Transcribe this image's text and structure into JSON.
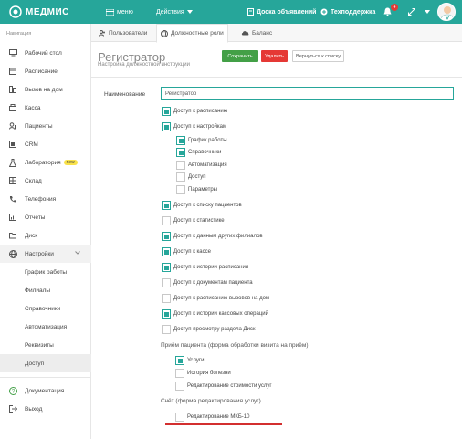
{
  "topbar": {
    "logo": "МЕДМИС",
    "menu": "меню",
    "actions": "Действия",
    "board": "Доска объявлений",
    "support": "Техподдержка",
    "notifications_count": "4"
  },
  "sidebar": {
    "caption": "Навигация",
    "items": [
      {
        "label": "Рабочий стол",
        "icon": "monitor-icon"
      },
      {
        "label": "Расписание",
        "icon": "calendar-icon"
      },
      {
        "label": "Вызов на дом",
        "icon": "car-icon"
      },
      {
        "label": "Касса",
        "icon": "cash-icon"
      },
      {
        "label": "Пациенты",
        "icon": "patients-icon"
      },
      {
        "label": "CRM",
        "icon": "crm-icon"
      },
      {
        "label": "Лаборатория",
        "icon": "flask-icon",
        "badge": "new"
      },
      {
        "label": "Склад",
        "icon": "warehouse-icon"
      },
      {
        "label": "Телефония",
        "icon": "phone-icon"
      },
      {
        "label": "Отчеты",
        "icon": "reports-icon"
      },
      {
        "label": "Диск",
        "icon": "disk-icon"
      },
      {
        "label": "Настройки",
        "icon": "globe-icon"
      }
    ],
    "settings_sub": [
      "График работы",
      "Филиалы",
      "Справочники",
      "Автоматизация",
      "Реквизиты",
      "Доступ"
    ],
    "bottom": [
      {
        "label": "Документация",
        "icon": "help-icon"
      },
      {
        "label": "Выход",
        "icon": "logout-icon"
      }
    ]
  },
  "tabs": [
    "Пользователи",
    "Должностные роли",
    "Баланс"
  ],
  "page": {
    "title": "Регистратор",
    "subtitle": "Настройка должностной инструкции",
    "save": "Сохранить",
    "delete": "Удалить",
    "back": "Вернуться к списку"
  },
  "form": {
    "name_label": "Наименование",
    "name_value": "Регистратор",
    "permissions": [
      {
        "label": "Доступ к расписанию",
        "checked": true
      },
      {
        "label": "Доступ к настройкам",
        "checked": true
      },
      {
        "label": "График работы",
        "checked": true
      },
      {
        "label": "Справочники",
        "checked": true
      },
      {
        "label": "Автоматизация",
        "checked": false
      },
      {
        "label": "Доступ",
        "checked": false
      },
      {
        "label": "Параметры",
        "checked": false
      },
      {
        "label": "Доступ к списку пациентов",
        "checked": true
      },
      {
        "label": "Доступ к статистике",
        "checked": false
      },
      {
        "label": "Доступ к данным других филиалов",
        "checked": true
      },
      {
        "label": "Доступ к кассе",
        "checked": true
      },
      {
        "label": "Доступ к истории расписания",
        "checked": true
      },
      {
        "label": "Доступ к документам пациента",
        "checked": false
      },
      {
        "label": "Доступ к расписанию вызовов на дом",
        "checked": false
      },
      {
        "label": "Доступ к истории кассовых операций",
        "checked": true
      },
      {
        "label": "Доступ просмотру раздела Диск",
        "checked": false
      }
    ],
    "reception_title": "Приём пациента (форма обработки визита на приём)",
    "reception": [
      {
        "label": "Услуги",
        "checked": true
      },
      {
        "label": "История болезни",
        "checked": false
      },
      {
        "label": "Редактирование стоимости услуг",
        "checked": false
      }
    ],
    "invoice_title": "Счёт (форма редактирования услуг)",
    "invoice": [
      {
        "label": "Редактирование МКБ-10",
        "checked": false
      }
    ]
  },
  "colors": {
    "accent": "#26a69a",
    "save": "#43a047",
    "delete": "#e53935",
    "highlight": "#d32f2f"
  }
}
